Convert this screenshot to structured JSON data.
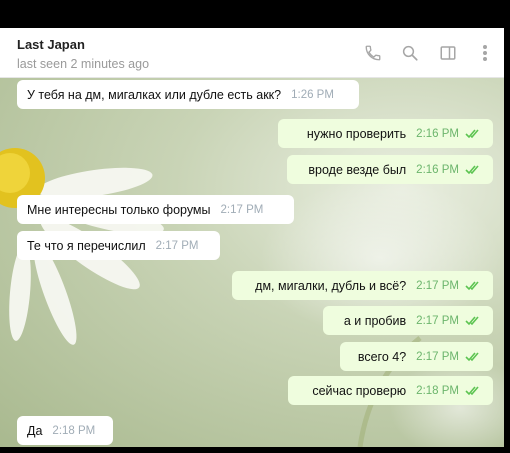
{
  "contact": {
    "name": "Last Japan",
    "status": "last seen 2 minutes ago"
  },
  "colors": {
    "outgoing_bubble": "#effdde",
    "incoming_bubble": "#ffffff",
    "read_check": "#5dc452",
    "header_icon": "#a6a6a6"
  },
  "header_icons": [
    "phone-icon",
    "search-icon",
    "sidebar-icon",
    "more-vertical-icon"
  ],
  "messages": [
    {
      "direction": "in",
      "text": "У тебя на дм, мигалках или дубле есть акк?",
      "time": "1:26 PM"
    },
    {
      "direction": "out",
      "text": "нужно проверить",
      "time": "2:16 PM",
      "read": true
    },
    {
      "direction": "out",
      "text": "вроде везде был",
      "time": "2:16 PM",
      "read": true
    },
    {
      "direction": "in",
      "text": "Мне интересны только форумы",
      "time": "2:17 PM"
    },
    {
      "direction": "in",
      "text": "Те что я перечислил",
      "time": "2:17 PM"
    },
    {
      "direction": "out",
      "text": "дм, мигалки, дубль и всё?",
      "time": "2:17 PM",
      "read": true
    },
    {
      "direction": "out",
      "text": "а и пробив",
      "time": "2:17 PM",
      "read": true
    },
    {
      "direction": "out",
      "text": "всего 4?",
      "time": "2:17 PM",
      "read": true
    },
    {
      "direction": "out",
      "text": "сейчас проверю",
      "time": "2:18 PM",
      "read": true
    },
    {
      "direction": "in",
      "text": "Да",
      "time": "2:18 PM"
    }
  ]
}
